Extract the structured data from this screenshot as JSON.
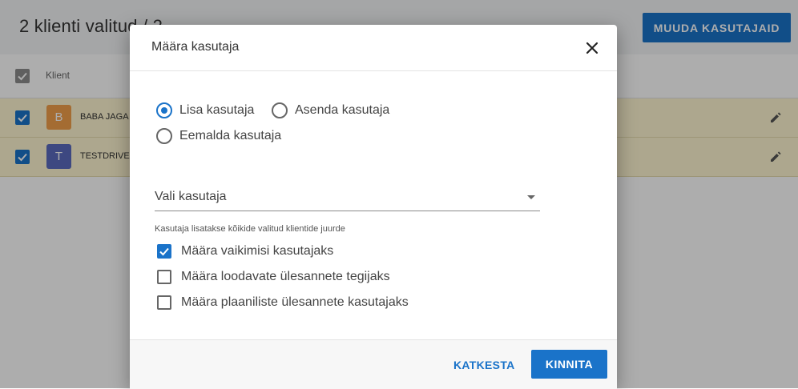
{
  "page": {
    "title": "2 klienti valitud / 2",
    "action_button": "MUUDA KASUTAJAID",
    "column_header": "Klient",
    "rows": [
      {
        "initial": "B",
        "name": "BABA JAGA",
        "avatar_color": "#f2a04a",
        "checked": true
      },
      {
        "initial": "T",
        "name": "TESTDRIVE",
        "avatar_color": "#5b6bbf",
        "checked": true
      }
    ]
  },
  "dialog": {
    "title": "Määra kasutaja",
    "mode_options": [
      {
        "label": "Lisa kasutaja",
        "selected": true
      },
      {
        "label": "Asenda kasutaja",
        "selected": false
      },
      {
        "label": "Eemalda kasutaja",
        "selected": false
      }
    ],
    "select": {
      "value": "Vali kasutaja"
    },
    "helper_text": "Kasutaja lisatakse kõikide valitud klientide juurde",
    "checkboxes": [
      {
        "label": "Määra vaikimisi kasutajaks",
        "checked": true
      },
      {
        "label": "Määra loodavate ülesannete tegijaks",
        "checked": false
      },
      {
        "label": "Määra plaaniliste ülesannete kasutajaks",
        "checked": false
      }
    ],
    "cancel_label": "KATKESTA",
    "confirm_label": "KINNITA"
  },
  "colors": {
    "accent": "#1a73c9",
    "row_highlight": "#fff7d1",
    "overlay": "rgba(0,0,0,0.32)"
  }
}
